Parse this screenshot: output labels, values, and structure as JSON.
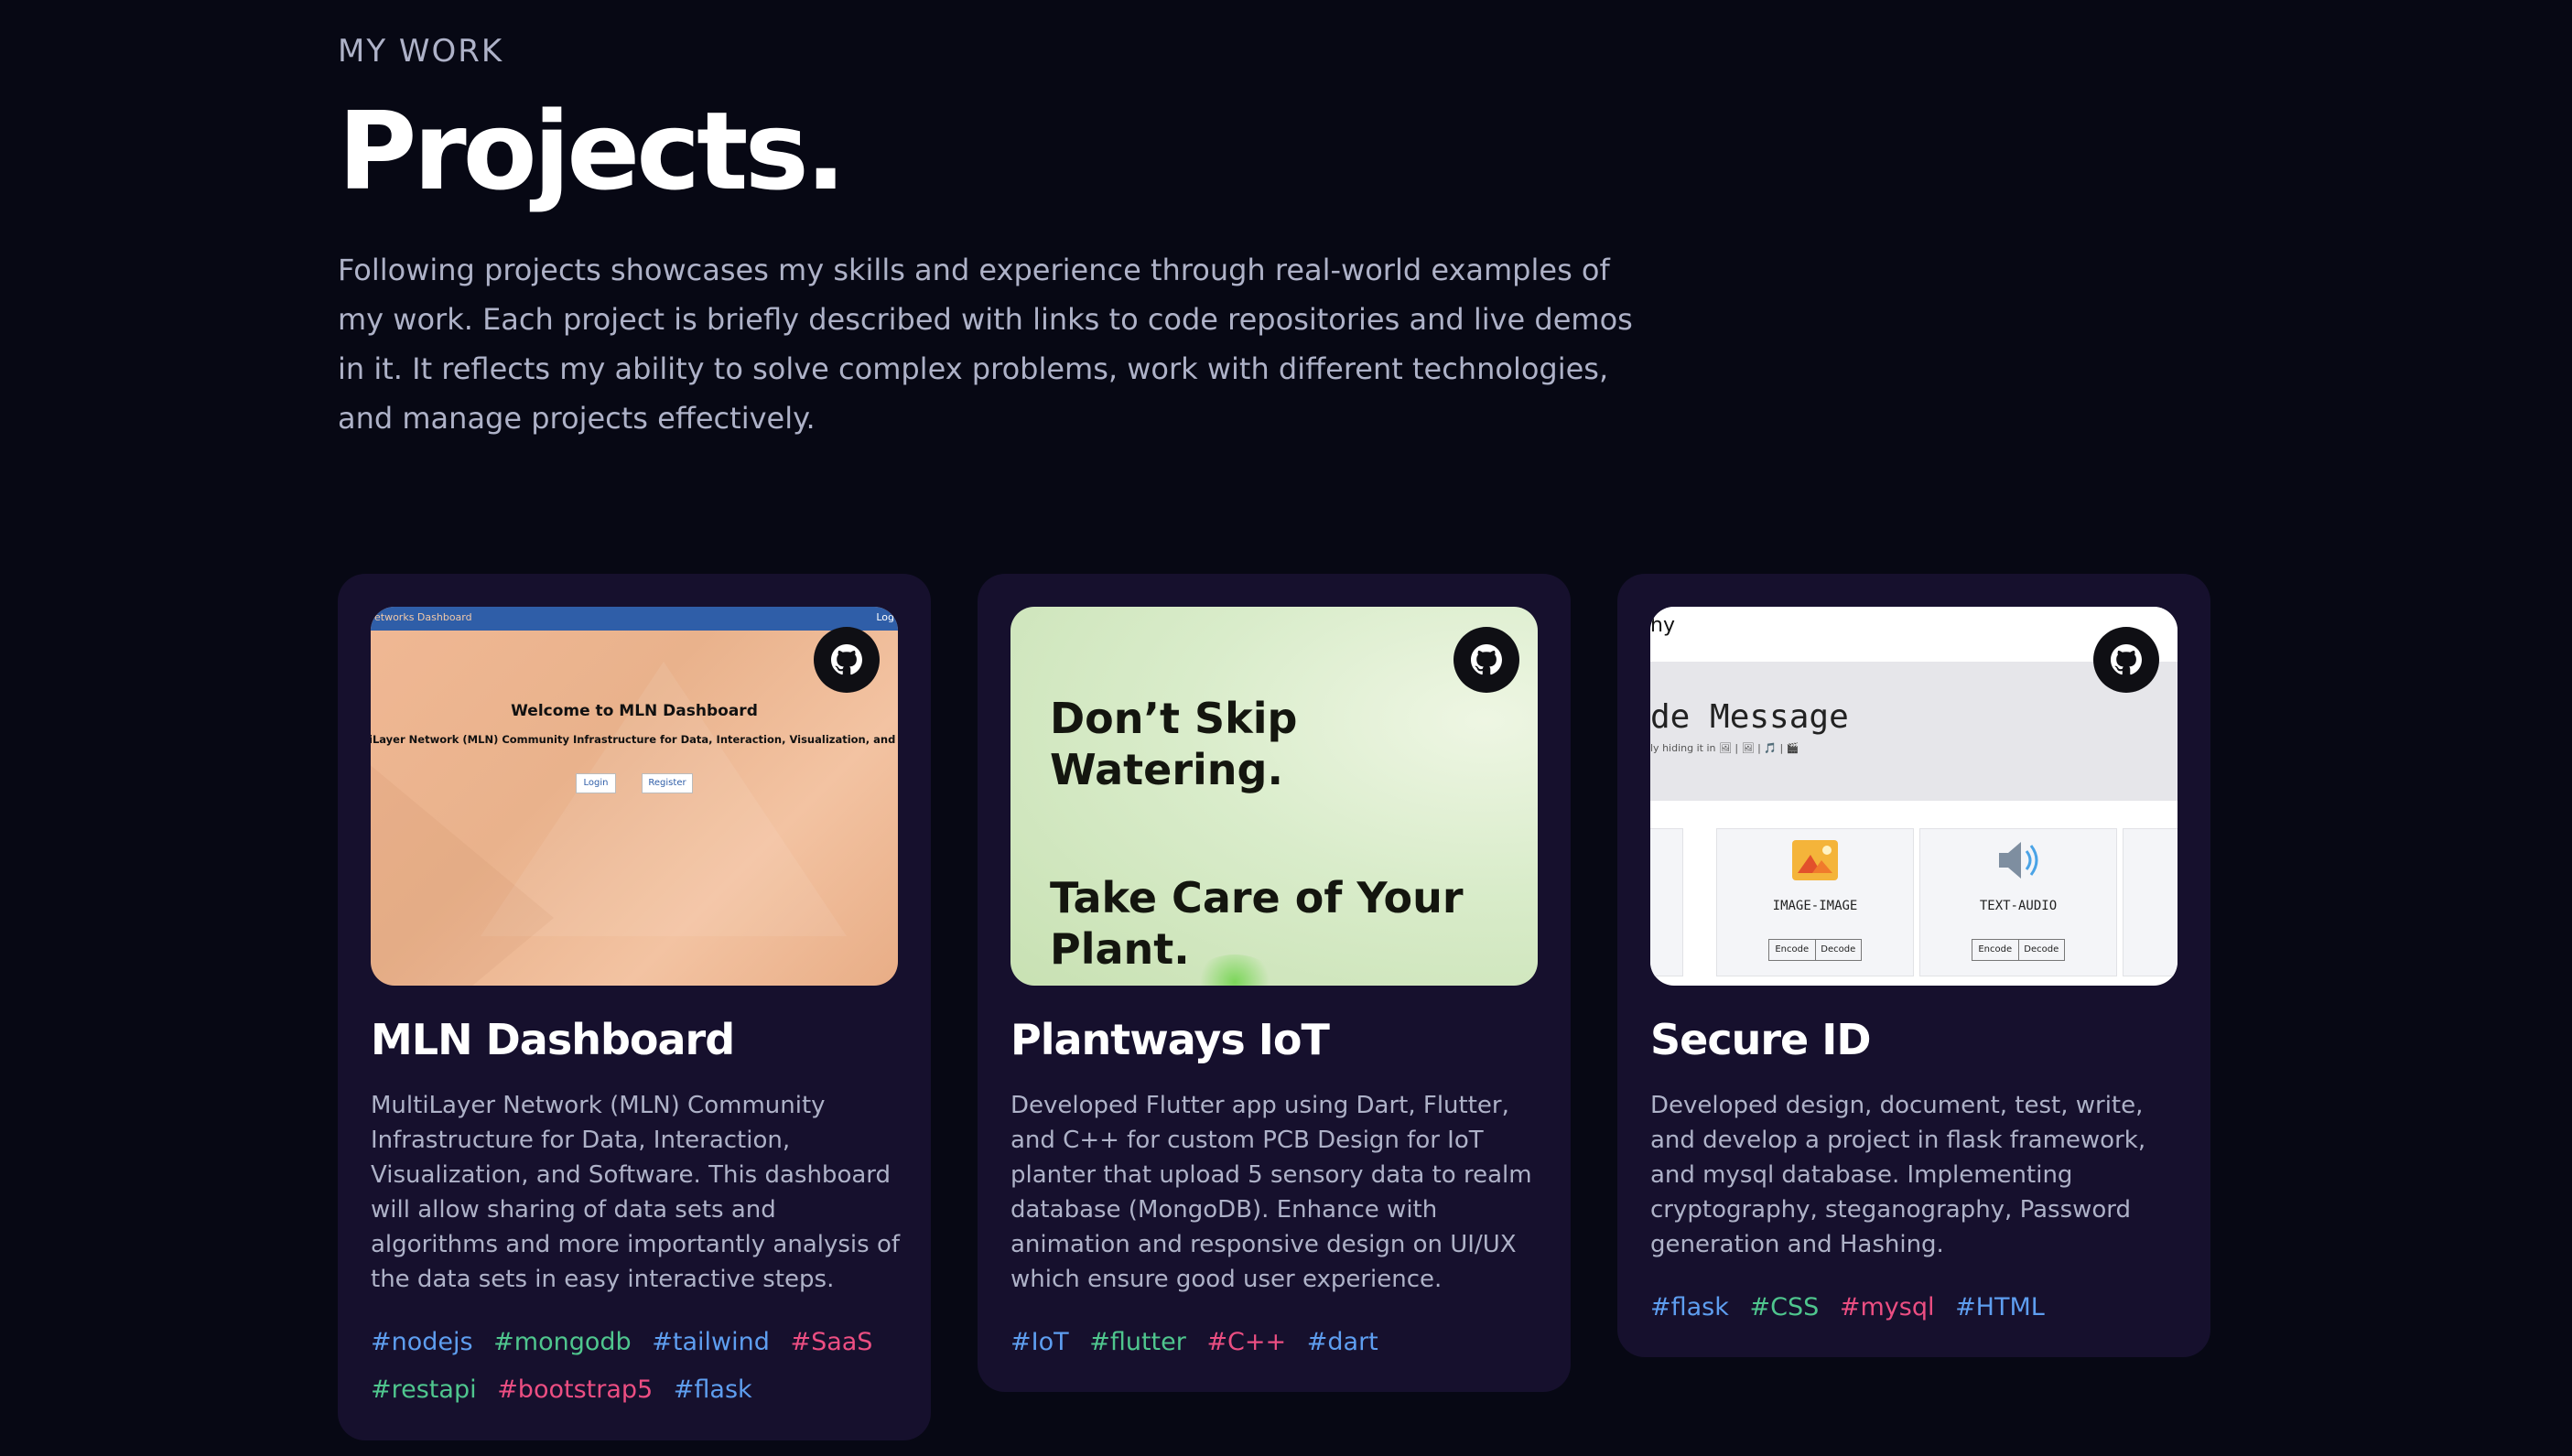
{
  "section": {
    "eyebrow": "MY WORK",
    "title": "Projects.",
    "intro": "Following projects showcases my skills and experience through real-world examples of my work. Each project is briefly described with links to code repositories and live demos in it. It reflects my ability to solve complex problems, work with different technologies, and manage projects effectively."
  },
  "colors": {
    "background": "#070814",
    "card": "#16102d",
    "tag_blue": "#5e9ef0",
    "tag_green": "#4fc68e",
    "tag_pink": "#ec4e82"
  },
  "projects": [
    {
      "title": "MLN Dashboard",
      "description": "MultiLayer Network (MLN) Community Infrastructure for Data, Interaction, Visualization, and Software. This dashboard will allow sharing of data sets and algorithms and more importantly analysis of the data sets in easy interactive steps.",
      "tags": [
        {
          "text": "#nodejs",
          "color": "blue"
        },
        {
          "text": "#mongodb",
          "color": "green"
        },
        {
          "text": "#tailwind",
          "color": "blue"
        },
        {
          "text": "#SaaS",
          "color": "pink"
        },
        {
          "text": "#restapi",
          "color": "green"
        },
        {
          "text": "#bootstrap5",
          "color": "pink"
        },
        {
          "text": "#flask",
          "color": "blue"
        }
      ],
      "preview": {
        "bar_left": "etworks Dashboard",
        "bar_right": "Log",
        "heading": "Welcome to MLN Dashboard",
        "subheading": "iLayer Network (MLN) Community Infrastructure for Data, Interaction, Visualization, and Softw",
        "login": "Login",
        "register": "Register"
      },
      "github_icon": "github-icon"
    },
    {
      "title": "Plantways IoT",
      "description": "Developed Flutter app using Dart, Flutter, and C++ for custom PCB Design for IoT planter that upload 5 sensory data to realm database (MongoDB). Enhance with animation and responsive design on UI/UX which ensure good user experience.",
      "tags": [
        {
          "text": "#IoT",
          "color": "blue"
        },
        {
          "text": "#flutter",
          "color": "green"
        },
        {
          "text": "#C++",
          "color": "pink"
        },
        {
          "text": "#dart",
          "color": "blue"
        }
      ],
      "preview": {
        "line1": "Don’t Skip",
        "line2": "Watering.",
        "line3": "Take Care of Your",
        "line4": "Plant."
      },
      "github_icon": "github-icon"
    },
    {
      "title": "Secure ID",
      "description": "Developed design, document, test, write, and develop a project in flask framework, and mysql database. Implementing cryptography, steganography, Password generation and Hashing.",
      "tags": [
        {
          "text": "#flask",
          "color": "blue"
        },
        {
          "text": "#CSS",
          "color": "green"
        },
        {
          "text": "#mysql",
          "color": "pink"
        },
        {
          "text": "#HTML",
          "color": "blue"
        }
      ],
      "preview": {
        "header": "hy",
        "title": "de Message",
        "caption": "ly hiding it in 🖼 | 🖼 | 🎵 | 🎬",
        "panel1": "IMAGE-IMAGE",
        "panel2": "TEXT-AUDIO",
        "encode": "Encode",
        "decode": "Decode"
      },
      "github_icon": "github-icon"
    }
  ]
}
